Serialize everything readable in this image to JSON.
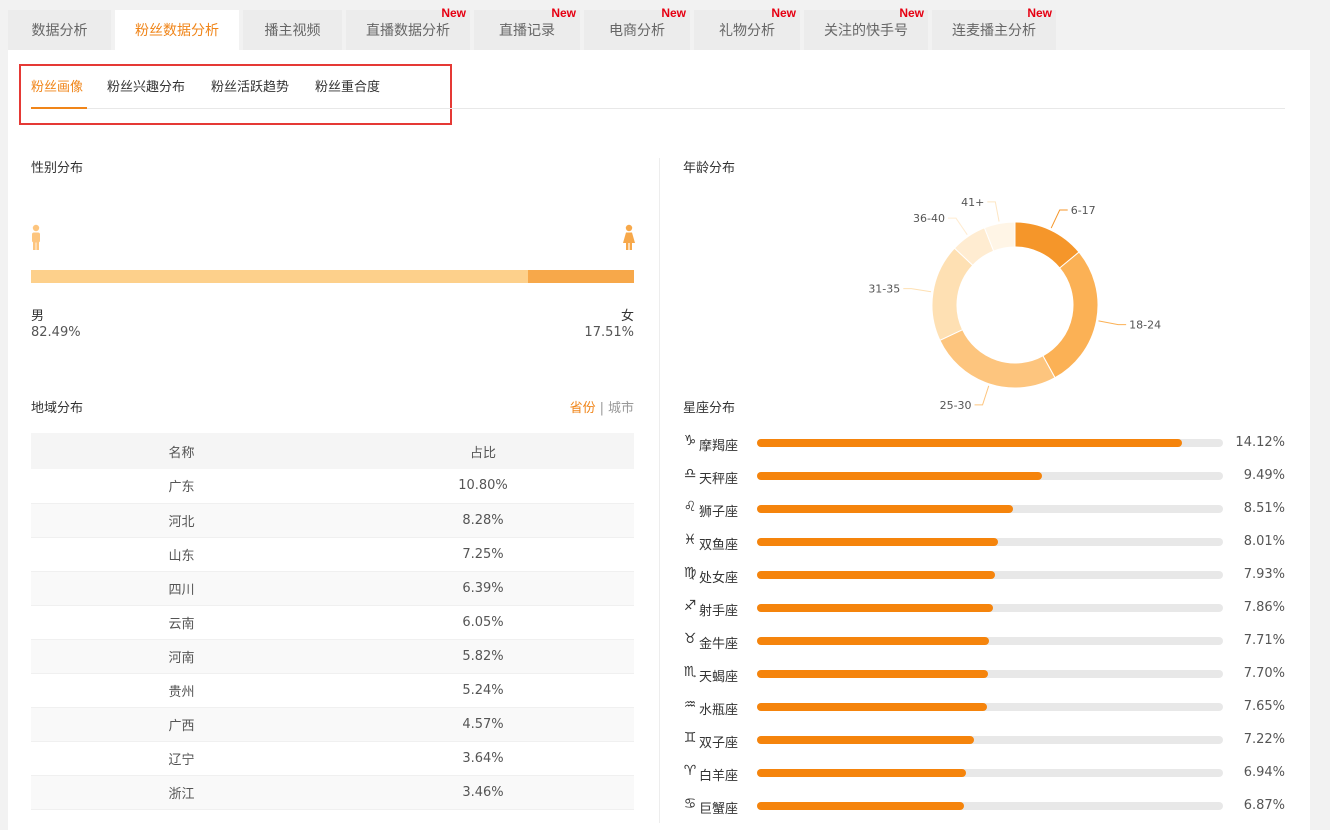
{
  "top_tabs": [
    {
      "label": "数据分析",
      "new": false,
      "width": 103,
      "active": false
    },
    {
      "label": "粉丝数据分析",
      "new": false,
      "width": 124,
      "active": true
    },
    {
      "label": "播主视频",
      "new": false,
      "width": 99,
      "active": false
    },
    {
      "label": "直播数据分析",
      "new": true,
      "width": 124,
      "active": false
    },
    {
      "label": "直播记录",
      "new": true,
      "width": 106,
      "active": false
    },
    {
      "label": "电商分析",
      "new": true,
      "width": 106,
      "active": false
    },
    {
      "label": "礼物分析",
      "new": true,
      "width": 106,
      "active": false
    },
    {
      "label": "关注的快手号",
      "new": true,
      "width": 124,
      "active": false
    },
    {
      "label": "连麦播主分析",
      "new": true,
      "width": 124,
      "active": false
    }
  ],
  "new_badge": "New",
  "sub_tabs": [
    "粉丝画像",
    "粉丝兴趣分布",
    "粉丝活跃趋势",
    "粉丝重合度"
  ],
  "gender": {
    "title": "性别分布",
    "male_label": "男",
    "male_pct": "82.49%",
    "male_value": 82.49,
    "female_label": "女",
    "female_pct": "17.51%",
    "female_value": 17.51,
    "male_color": "#fdd08b",
    "female_color": "#f7a84a"
  },
  "region": {
    "title": "地域分布",
    "toggle_province": "省份",
    "toggle_sep": "|",
    "toggle_city": "城市",
    "col_name": "名称",
    "col_ratio": "占比",
    "rows": [
      {
        "name": "广东",
        "ratio": "10.80%"
      },
      {
        "name": "河北",
        "ratio": "8.28%"
      },
      {
        "name": "山东",
        "ratio": "7.25%"
      },
      {
        "name": "四川",
        "ratio": "6.39%"
      },
      {
        "name": "云南",
        "ratio": "6.05%"
      },
      {
        "name": "河南",
        "ratio": "5.82%"
      },
      {
        "name": "贵州",
        "ratio": "5.24%"
      },
      {
        "name": "广西",
        "ratio": "4.57%"
      },
      {
        "name": "辽宁",
        "ratio": "3.64%"
      },
      {
        "name": "浙江",
        "ratio": "3.46%"
      }
    ]
  },
  "age": {
    "title": "年龄分布",
    "segments": [
      {
        "label": "6-17",
        "value": 14,
        "color": "#f5962a"
      },
      {
        "label": "18-24",
        "value": 28,
        "color": "#fbb155"
      },
      {
        "label": "25-30",
        "value": 26,
        "color": "#fdc57e"
      },
      {
        "label": "31-35",
        "value": 19,
        "color": "#fee0b3"
      },
      {
        "label": "36-40",
        "value": 7,
        "color": "#ffecd1"
      },
      {
        "label": "41+",
        "value": 6,
        "color": "#fff5e6"
      }
    ]
  },
  "zodiac": {
    "title": "星座分布",
    "items": [
      {
        "icon": "♑",
        "name": "摩羯座",
        "pct": "14.12%",
        "value": 14.12
      },
      {
        "icon": "♎",
        "name": "天秤座",
        "pct": "9.49%",
        "value": 9.49
      },
      {
        "icon": "♌",
        "name": "狮子座",
        "pct": "8.51%",
        "value": 8.51
      },
      {
        "icon": "♓",
        "name": "双鱼座",
        "pct": "8.01%",
        "value": 8.01
      },
      {
        "icon": "♍",
        "name": "处女座",
        "pct": "7.93%",
        "value": 7.93
      },
      {
        "icon": "♐",
        "name": "射手座",
        "pct": "7.86%",
        "value": 7.86
      },
      {
        "icon": "♉",
        "name": "金牛座",
        "pct": "7.71%",
        "value": 7.71
      },
      {
        "icon": "♏",
        "name": "天蝎座",
        "pct": "7.70%",
        "value": 7.7
      },
      {
        "icon": "♒",
        "name": "水瓶座",
        "pct": "7.65%",
        "value": 7.65
      },
      {
        "icon": "♊",
        "name": "双子座",
        "pct": "7.22%",
        "value": 7.22
      },
      {
        "icon": "♈",
        "name": "白羊座",
        "pct": "6.94%",
        "value": 6.94
      },
      {
        "icon": "♋",
        "name": "巨蟹座",
        "pct": "6.87%",
        "value": 6.87
      }
    ],
    "scale_max": 15.5
  }
}
